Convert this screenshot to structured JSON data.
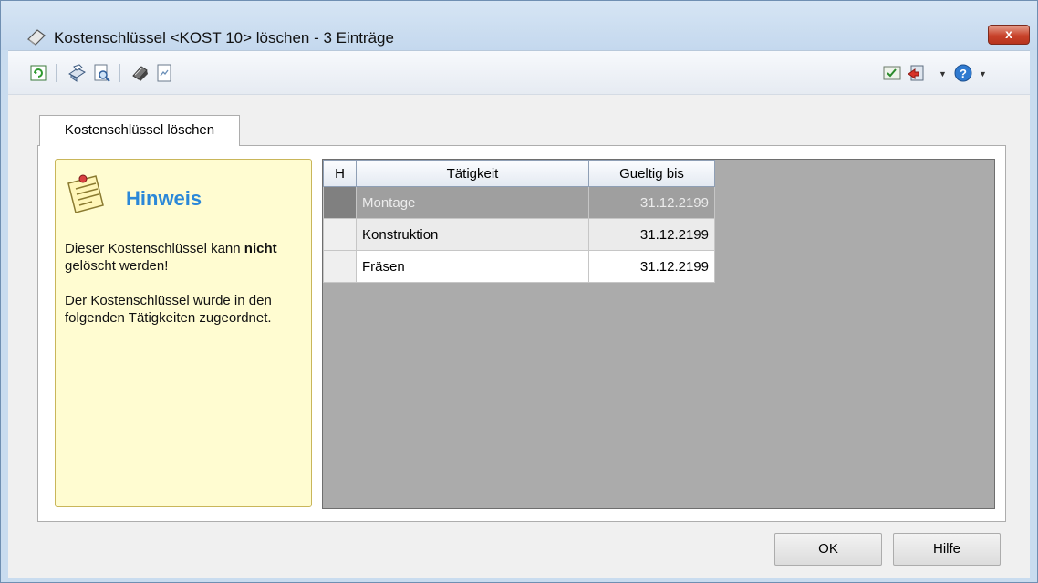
{
  "window": {
    "title": "Kostenschlüssel <KOST 10> löschen - 3 Einträge",
    "close_label": "x"
  },
  "toolbar": {
    "left_icons": [
      "refresh-icon",
      "print-icon",
      "print-preview-icon",
      "export-icon",
      "document-icon"
    ],
    "right_icons": [
      "checklist-icon",
      "exit-icon",
      "help-icon"
    ]
  },
  "tab": {
    "label": "Kostenschlüssel löschen"
  },
  "hint": {
    "title": "Hinweis",
    "line1_prefix": "Dieser Kostenschlüssel kann",
    "line1_bold": "nicht",
    "line1_suffix": "gelöscht werden!",
    "line2": "Der Kostenschlüssel wurde in den folgenden Tätigkeiten zugeordnet."
  },
  "grid": {
    "columns": [
      "H",
      "Tätigkeit",
      "Gueltig bis"
    ],
    "rows": [
      {
        "h": "",
        "taetigkeit": "Montage",
        "gueltig_bis": "31.12.2199"
      },
      {
        "h": "",
        "taetigkeit": "Konstruktion",
        "gueltig_bis": "31.12.2199"
      },
      {
        "h": "",
        "taetigkeit": "Fräsen",
        "gueltig_bis": "31.12.2199"
      }
    ]
  },
  "buttons": {
    "ok": "OK",
    "help": "Hilfe"
  },
  "colors": {
    "hint_title": "#2b88d8",
    "hint_bg": "#fffcd1",
    "grid_bg": "#ababab"
  }
}
